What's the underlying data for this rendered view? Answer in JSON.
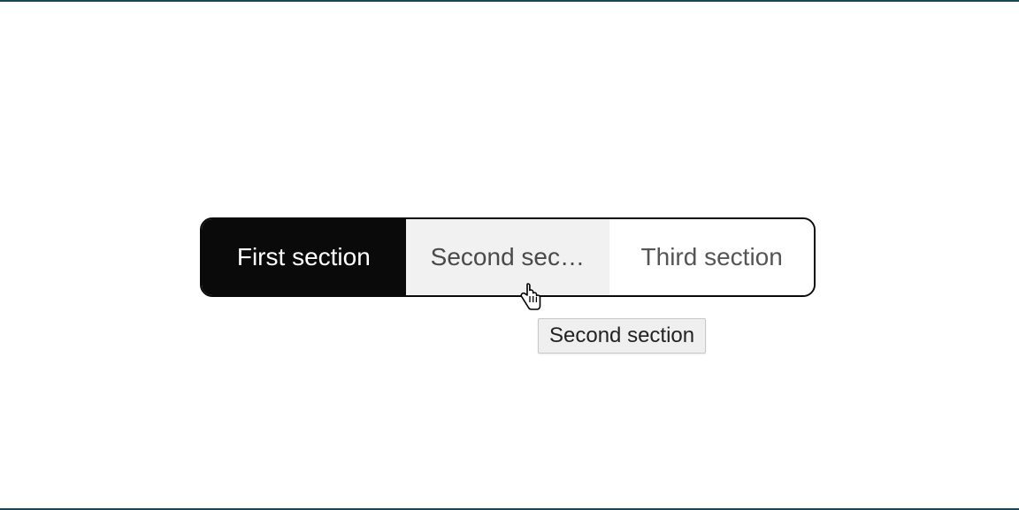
{
  "segments": [
    {
      "label": "First section",
      "state": "active"
    },
    {
      "label": "Second section",
      "display_label": "Second sect...",
      "state": "hover"
    },
    {
      "label": "Third section",
      "state": "inactive"
    }
  ],
  "tooltip_text": "Second section"
}
